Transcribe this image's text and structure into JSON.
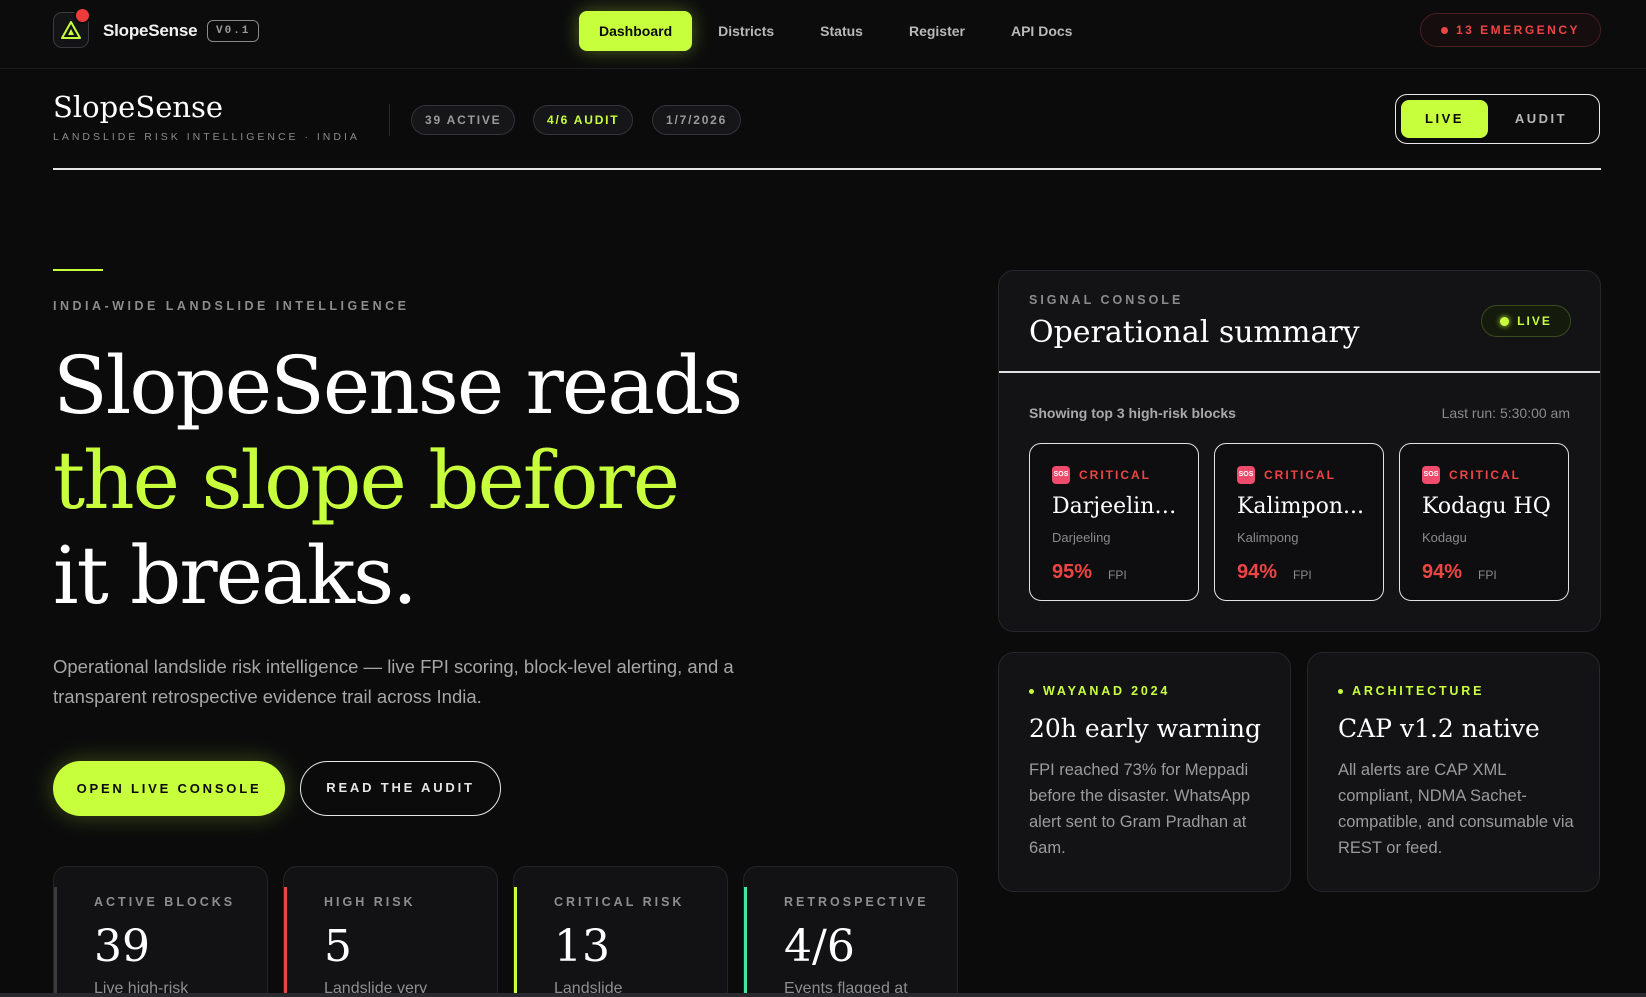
{
  "nav": {
    "brand": "SlopeSense",
    "version": "V0.1",
    "links": [
      {
        "label": "Dashboard"
      },
      {
        "label": "Districts"
      },
      {
        "label": "Status"
      },
      {
        "label": "Register"
      },
      {
        "label": "API Docs"
      }
    ],
    "emergency": "13 EMERGENCY"
  },
  "subheader": {
    "brand": "SlopeSense",
    "tagline": "LANDSLIDE RISK INTELLIGENCE · INDIA",
    "chips": [
      "39 ACTIVE",
      "4/6 AUDIT",
      "1/7/2026"
    ],
    "mode_live": "LIVE",
    "mode_audit": "AUDIT"
  },
  "hero": {
    "eyebrow": "INDIA-WIDE LANDSLIDE INTELLIGENCE",
    "line1": "SlopeSense reads",
    "line2": "the slope before",
    "line3": "it breaks.",
    "description": "Operational landslide risk intelligence — live FPI scoring, block-level alerting, and a transparent retrospective evidence trail across India.",
    "primary_cta": "OPEN LIVE CONSOLE",
    "secondary_cta": "READ THE AUDIT"
  },
  "stats": [
    {
      "label": "ACTIVE BLOCKS",
      "value": "39",
      "desc": "Live high-risk",
      "color": "#3a3a3f"
    },
    {
      "label": "HIGH RISK",
      "value": "5",
      "desc": "Landslide very",
      "color": "#ef4444"
    },
    {
      "label": "CRITICAL RISK",
      "value": "13",
      "desc": "Landslide",
      "color": "#c8ff3c"
    },
    {
      "label": "RETROSPECTIVE",
      "value": "4/6",
      "desc": "Events flagged at",
      "color": "#3ee8a0"
    }
  ],
  "console": {
    "eyebrow": "SIGNAL CONSOLE",
    "title": "Operational summary",
    "live": "LIVE",
    "showing": "Showing top 3 high-risk blocks",
    "last_run": "Last run: 5:30:00 am",
    "cards": [
      {
        "severity": "CRITICAL",
        "name": "Darjeeling...",
        "district": "Darjeeling",
        "fpi": "95%",
        "fpi_label": "FPI",
        "icon": "sos-icon"
      },
      {
        "severity": "CRITICAL",
        "name": "Kalimpon...",
        "district": "Kalimpong",
        "fpi": "94%",
        "fpi_label": "FPI",
        "icon": "sos-icon"
      },
      {
        "severity": "CRITICAL",
        "name": "Kodagu HQ",
        "district": "Kodagu",
        "fpi": "94%",
        "fpi_label": "FPI",
        "icon": "sos-icon"
      }
    ]
  },
  "info_cards": [
    {
      "tag": "WAYANAD 2024",
      "heading": "20h early warning",
      "body": "FPI reached 73% for Meppadi before the disaster. WhatsApp alert sent to Gram Pradhan at 6am."
    },
    {
      "tag": "ARCHITECTURE",
      "heading": "CAP v1.2 native",
      "body": "All alerts are CAP XML compliant, NDMA Sachet-compatible, and consumable via REST or feed."
    }
  ],
  "colors": {
    "accent": "#c8ff3c",
    "danger": "#ef4444",
    "background": "#0b0b0c"
  }
}
